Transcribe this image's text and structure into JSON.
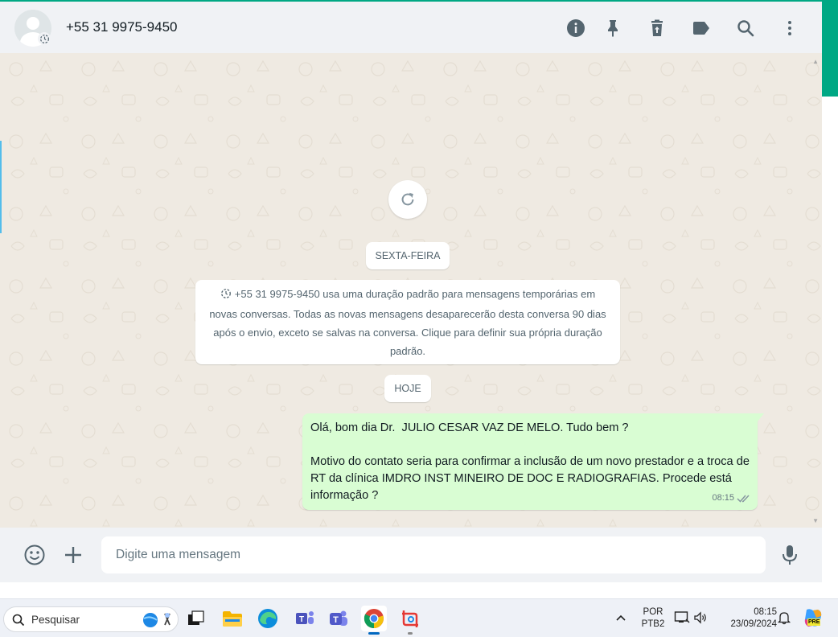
{
  "header": {
    "contact_name": "+55 31 9975-9450",
    "icons": [
      "info-icon",
      "pin-icon",
      "delete-icon",
      "label-icon",
      "search-icon",
      "menu-icon"
    ]
  },
  "chat": {
    "date_chip_1": "SEXTA-FEIRA",
    "system_message": "+55 31 9975-9450 usa uma duração padrão para mensagens temporárias em novas conversas. Todas as novas mensagens desaparecerão desta conversa 90 dias após o envio, exceto se salvas na conversa. Clique para definir sua própria duração padrão.",
    "date_chip_2": "HOJE",
    "message": {
      "line1": "Olá, bom dia Dr.  JULIO CESAR VAZ DE MELO. Tudo bem ?",
      "line2": "Motivo do contato seria para confirmar a inclusão de um novo prestador e a troca de RT da clínica IMDRO INST MINEIRO DE DOC E RADIOGRAFIAS. Procede está informação ?",
      "time": "08:15",
      "status": "read"
    }
  },
  "composer": {
    "placeholder": "Digite uma mensagem"
  },
  "taskbar": {
    "search_placeholder": "Pesquisar",
    "language": "POR",
    "layout": "PTB2",
    "time": "08:15",
    "date": "23/09/2024",
    "pre_badge": "PRE"
  },
  "colors": {
    "accent": "#00a884",
    "bubble_out": "#d9fdd3",
    "chat_bg": "#efeae2",
    "panel_bg": "#f0f2f5",
    "read_ticks": "#8696a0"
  }
}
